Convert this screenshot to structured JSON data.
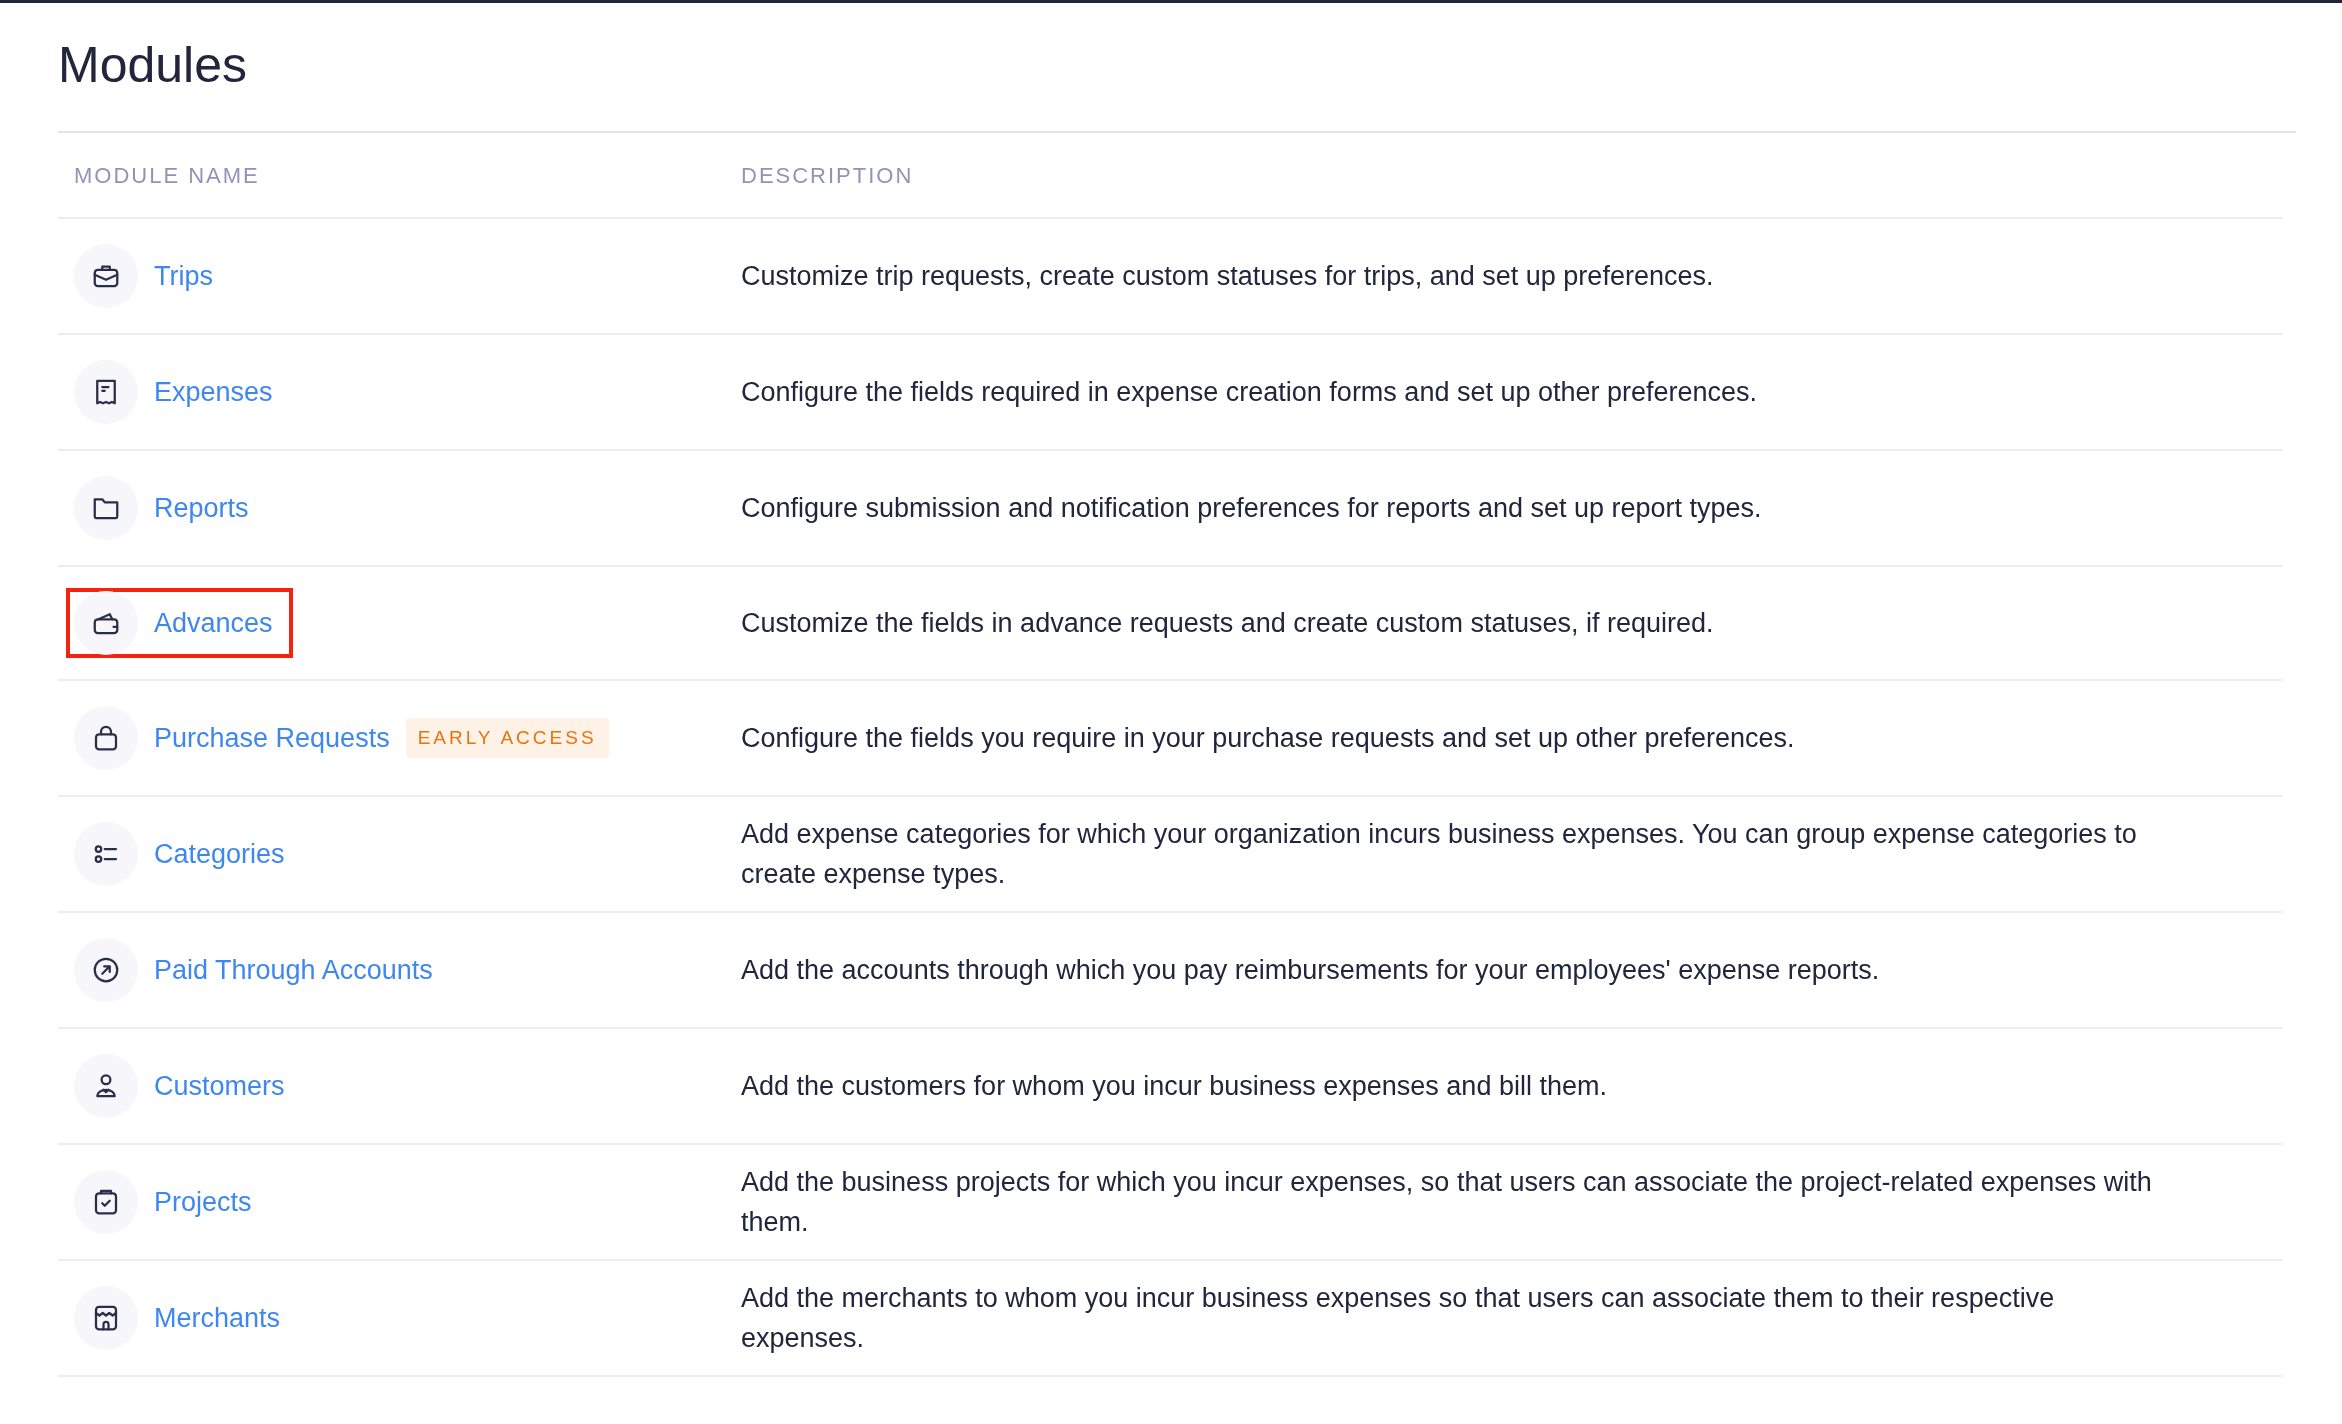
{
  "page": {
    "title": "Modules"
  },
  "table": {
    "columns": [
      "MODULE NAME",
      "DESCRIPTION"
    ],
    "rows": [
      {
        "name": "Trips",
        "highlighted": false,
        "description": "Customize trip requests, create custom statuses for trips, and set up preferences."
      },
      {
        "name": "Expenses",
        "highlighted": false,
        "description": "Configure the fields required in expense creation forms and set up other preferences."
      },
      {
        "name": "Reports",
        "highlighted": false,
        "description": "Configure submission and notification preferences for reports and set up report types."
      },
      {
        "name": "Advances",
        "highlighted": true,
        "description": "Customize the fields in advance requests and create custom statuses, if required."
      },
      {
        "name": "Purchase Requests",
        "badge": "EARLY ACCESS",
        "highlighted": false,
        "description": "Configure the fields you require in your purchase requests and set up other preferences."
      },
      {
        "name": "Categories",
        "highlighted": false,
        "description": "Add expense categories for which your organization incurs business expenses. You can group expense categories to create expense types."
      },
      {
        "name": "Paid Through Accounts",
        "highlighted": false,
        "description": "Add the accounts through which you pay reimbursements for your employees' expense reports."
      },
      {
        "name": "Customers",
        "highlighted": false,
        "description": "Add the customers for whom you incur business expenses and bill them."
      },
      {
        "name": "Projects",
        "highlighted": false,
        "description": "Add the business projects for which you incur expenses, so that users can associate the project-related expenses with them."
      },
      {
        "name": "Merchants",
        "highlighted": false,
        "description": "Add the merchants to whom you incur business expenses so that users can associate them to their respective expenses."
      }
    ]
  }
}
